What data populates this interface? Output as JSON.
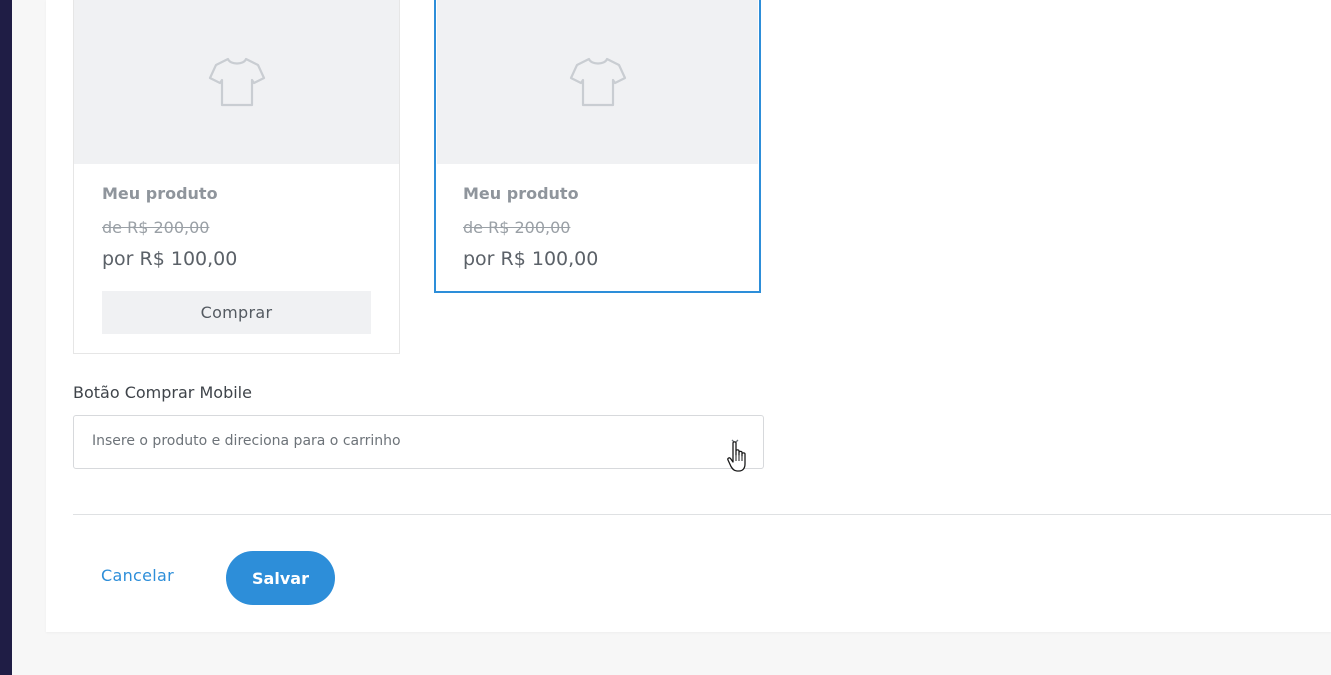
{
  "product_cards": [
    {
      "name": "Meu produto",
      "old_price": "de R$ 200,00",
      "new_price": "por R$ 100,00",
      "buy_label": "Comprar",
      "image_icon": "tshirt-icon"
    },
    {
      "name": "Meu produto",
      "old_price": "de R$ 200,00",
      "new_price": "por R$ 100,00",
      "image_icon": "tshirt-icon",
      "selected": true
    }
  ],
  "mobile_buy_button": {
    "label": "Botão Comprar Mobile",
    "selected_value": "Insere o produto e direciona para o carrinho"
  },
  "actions": {
    "cancel_label": "Cancelar",
    "save_label": "Salvar"
  },
  "colors": {
    "accent": "#2d8ed9",
    "sidebar": "#1f1d45"
  }
}
